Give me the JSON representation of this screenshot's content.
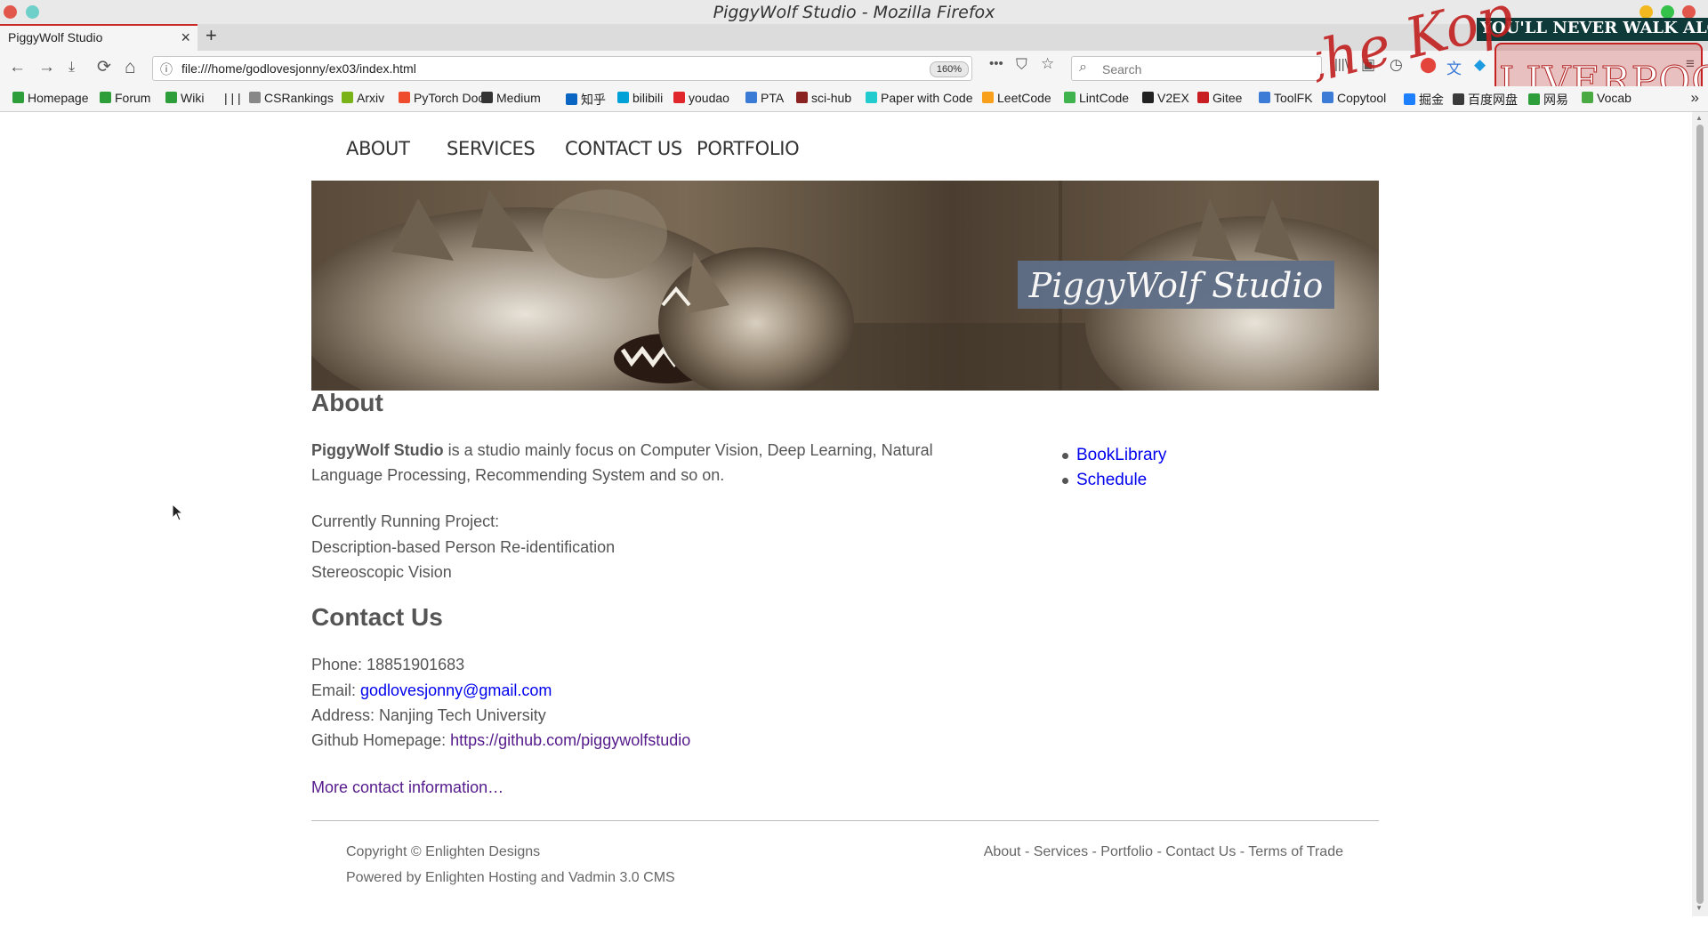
{
  "window": {
    "title": "PiggyWolf Studio - Mozilla Firefox"
  },
  "tab": {
    "title": "PiggyWolf Studio",
    "close": "×",
    "new_tab": "+"
  },
  "nav": {
    "back": "←",
    "forward": "→",
    "reload": "⟳",
    "home": "⌂",
    "url": "file:///home/godlovesjonny/ex03/index.html",
    "zoom": "160%",
    "page_actions": "•••",
    "search_placeholder": "Search"
  },
  "theme": {
    "text1": "YOU'LL NEVER WALK ALONE",
    "text2": "LIVERPOOL",
    "text3": "the Kop"
  },
  "bookmarks": [
    {
      "label": "Homepage",
      "color": "#2e9e3b"
    },
    {
      "label": "Forum",
      "color": "#2e9e3b"
    },
    {
      "label": "Wiki",
      "color": "#2e9e3b"
    },
    {
      "label": "| | |",
      "color": "#f5f5f5"
    },
    {
      "label": "CSRankings",
      "color": "#888888"
    },
    {
      "label": "Arxiv",
      "color": "#7ab317"
    },
    {
      "label": "PyTorch Doc",
      "color": "#ee4c2c"
    },
    {
      "label": "Medium",
      "color": "#333333"
    },
    {
      "label": "知乎",
      "color": "#0a66c2"
    },
    {
      "label": "bilibili",
      "color": "#00a1d6"
    },
    {
      "label": "youdao",
      "color": "#e0262a"
    },
    {
      "label": "PTA",
      "color": "#3a7bd5"
    },
    {
      "label": "sci-hub",
      "color": "#8b2222"
    },
    {
      "label": "Paper with Code",
      "color": "#21cbce"
    },
    {
      "label": "LeetCode",
      "color": "#f89f1b"
    },
    {
      "label": "LintCode",
      "color": "#40b34f"
    },
    {
      "label": "V2EX",
      "color": "#222222"
    },
    {
      "label": "Gitee",
      "color": "#c71d23"
    },
    {
      "label": "ToolFK",
      "color": "#3c7bd6"
    },
    {
      "label": "Copytool",
      "color": "#3c7bd6"
    },
    {
      "label": "掘金",
      "color": "#1e80ff"
    },
    {
      "label": "百度网盘",
      "color": "#3a3a3a"
    },
    {
      "label": "网易",
      "color": "#2e9e3b"
    },
    {
      "label": "Vocab",
      "color": "#49a942"
    }
  ],
  "site": {
    "menu": [
      "ABOUT",
      "SERVICES",
      "CONTACT US",
      "PORTFOLIO"
    ],
    "banner_title": "PiggyWolf Studio",
    "about_heading": "About",
    "about_name": "PiggyWolf Studio",
    "about_text": " is a studio mainly focus on Computer Vision, Deep Learning, Natural Language Processing, Recommending System and so on.",
    "project_heading": "Currently Running Project:",
    "projects": [
      "Description-based Person Re-identification",
      "Stereoscopic Vision"
    ],
    "sidebar_links": [
      "BookLibrary",
      "Schedule"
    ],
    "contact_heading": "Contact Us",
    "phone_label": "Phone: ",
    "phone": "18851901683",
    "email_label": "Email: ",
    "email": "godlovesjonny@gmail.com",
    "address_label": "Address: ",
    "address": "Nanjing Tech University",
    "github_label": "Github Homepage: ",
    "github": "https://github.com/piggywolfstudio",
    "more_contact": "More contact information…",
    "footer_copyright": "Copyright © Enlighten Designs",
    "footer_powered": "Powered by Enlighten Hosting and Vadmin 3.0 CMS",
    "footer_links": [
      "About",
      "Services",
      "Portfolio",
      "Contact Us",
      "Terms of Trade"
    ],
    "footer_sep": " - "
  }
}
